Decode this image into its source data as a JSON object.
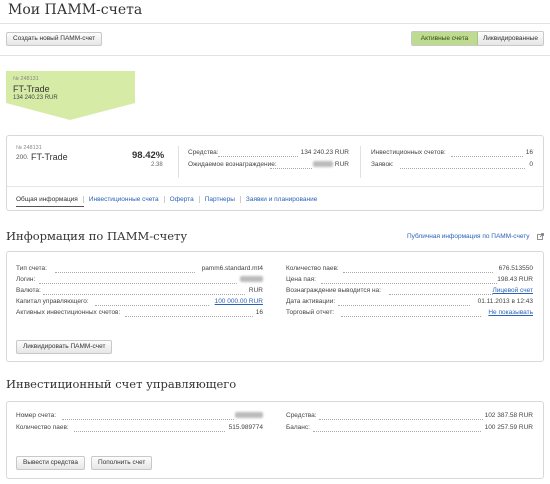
{
  "page": {
    "title": "Мои ПАММ-счета"
  },
  "toolbar": {
    "create_label": "Создать новый ПАММ-счет",
    "filter_active": "Активные счета",
    "filter_liquidated": "Ликвидированные"
  },
  "card": {
    "number": "№ 248131",
    "name": "FT-Trade",
    "amount": "134 240.23 RUR",
    "color": "#d6eba6"
  },
  "summary": {
    "number": "№ 248131",
    "index": "200.",
    "name": "FT-Trade",
    "percent": "98.42%",
    "sub": "2.38",
    "funds_label": "Средства:",
    "funds_value": "134 240.23 RUR",
    "reward_label": "Ожидаемое вознаграждение:",
    "reward_value": "RUR",
    "inv_accounts_label": "Инвестиционных счетов:",
    "inv_accounts_value": "16",
    "requests_label": "Заявок:",
    "requests_value": "0"
  },
  "tabs": [
    "Общая информация",
    "Инвестиционные счета",
    "Оферта",
    "Партнеры",
    "Заявки и планирование"
  ],
  "info": {
    "heading": "Информация по ПАММ-счету",
    "public_link": "Публичная информация по ПАММ-счету",
    "left": [
      {
        "label": "Тип счета:",
        "value": "pamm6.standard.mt4"
      },
      {
        "label": "Логин:",
        "value": ""
      },
      {
        "label": "Валюта:",
        "value": "RUR"
      },
      {
        "label": "Капитал управляющего:",
        "value": "100 000.00 RUR"
      },
      {
        "label": "Активных инвестиционных счетов:",
        "value": "16"
      }
    ],
    "right": [
      {
        "label": "Количество паев:",
        "value": "676.513550"
      },
      {
        "label": "Цена пая:",
        "value": "198.43 RUR"
      },
      {
        "label": "Вознаграждение выводится на:",
        "value": "Лицевой счет"
      },
      {
        "label": "Дата активации:",
        "value": "01.11.2013 в 12:43"
      },
      {
        "label": "Торговый отчет:",
        "value": "Не показывать"
      }
    ],
    "liquidate_label": "Ликвидировать ПАММ-счет"
  },
  "manager": {
    "heading": "Инвестиционный счет управляющего",
    "left": [
      {
        "label": "Номер счета:",
        "value": ""
      },
      {
        "label": "Количество паев:",
        "value": "515.989774"
      }
    ],
    "right": [
      {
        "label": "Средства:",
        "value": "102 387.58 RUR"
      },
      {
        "label": "Баланс:",
        "value": "100 257.59 RUR"
      }
    ],
    "withdraw_label": "Вывести средства",
    "deposit_label": "Пополнить счет"
  }
}
